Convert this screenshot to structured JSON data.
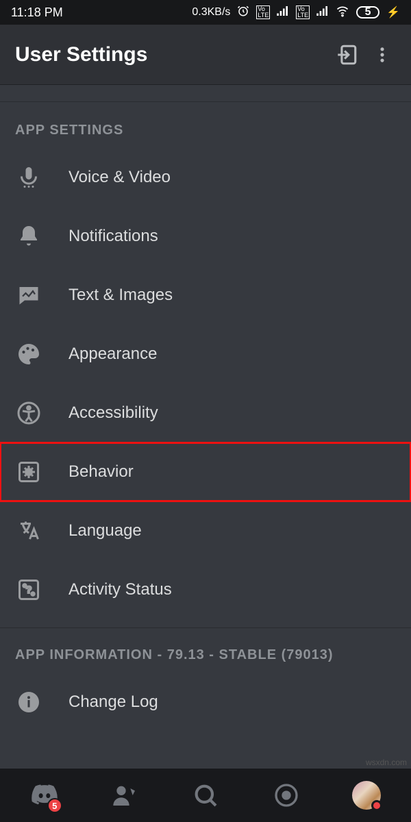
{
  "statusbar": {
    "time": "11:18 PM",
    "data_rate": "0.3KB/s",
    "battery_level": "5"
  },
  "header": {
    "title": "User Settings"
  },
  "sections": {
    "app_settings": {
      "label": "APP SETTINGS",
      "items": [
        {
          "label": "Voice & Video"
        },
        {
          "label": "Notifications"
        },
        {
          "label": "Text & Images"
        },
        {
          "label": "Appearance"
        },
        {
          "label": "Accessibility"
        },
        {
          "label": "Behavior"
        },
        {
          "label": "Language"
        },
        {
          "label": "Activity Status"
        }
      ]
    },
    "app_information": {
      "label": "APP INFORMATION - 79.13 - STABLE (79013)",
      "items": [
        {
          "label": "Change Log"
        }
      ]
    }
  },
  "bottomnav": {
    "badge_count": "5"
  },
  "highlight_item_index": 5,
  "watermark": "wsxdn.com"
}
